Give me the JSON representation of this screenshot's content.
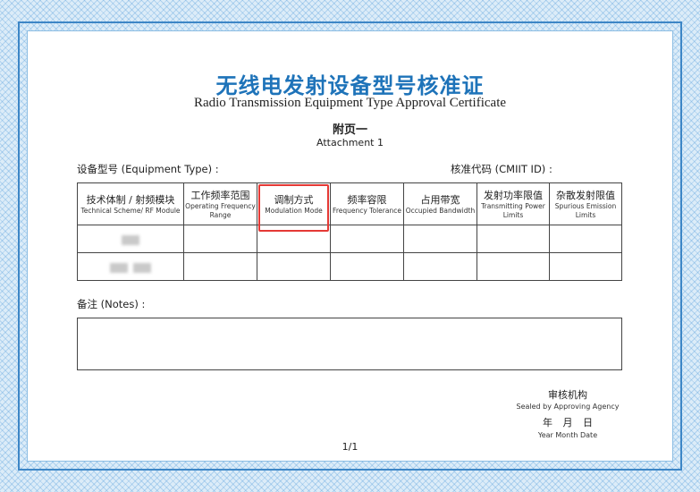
{
  "certificate": {
    "title_cn": "无线电发射设备型号核准证",
    "title_en": "Radio Transmission Equipment Type Approval Certificate",
    "attachment_cn": "附页一",
    "attachment_en": "Attachment 1"
  },
  "fields": {
    "equipment_type_label": "设备型号 (Equipment Type) :",
    "cmiit_id_label": "核准代码 (CMIIT ID) :"
  },
  "table": {
    "columns": [
      {
        "cn": "技术体制 / 射频模块",
        "en": "Technical Scheme/ RF Module"
      },
      {
        "cn": "工作频率范围",
        "en": "Operating Frequency Range"
      },
      {
        "cn": "调制方式",
        "en": "Modulation Mode"
      },
      {
        "cn": "频率容限",
        "en": "Frequency Tolerance"
      },
      {
        "cn": "占用带宽",
        "en": "Occupied Bandwidth"
      },
      {
        "cn": "发射功率限值",
        "en": "Transmitting Power Limits"
      },
      {
        "cn": "杂散发射限值",
        "en": "Spurious Emission Limits"
      }
    ],
    "highlighted_column": 2,
    "highlight_color": "#e53935"
  },
  "notes": {
    "label": "备注 (Notes) :"
  },
  "agency": {
    "cn": "审核机构",
    "en": "Sealed by Approving Agency",
    "date_cn": "年 月 日",
    "date_en": "Year Month Date"
  },
  "page_number": "1/1",
  "colors": {
    "title_blue": "#1e73b9",
    "border_blue": "#3d86c6"
  }
}
